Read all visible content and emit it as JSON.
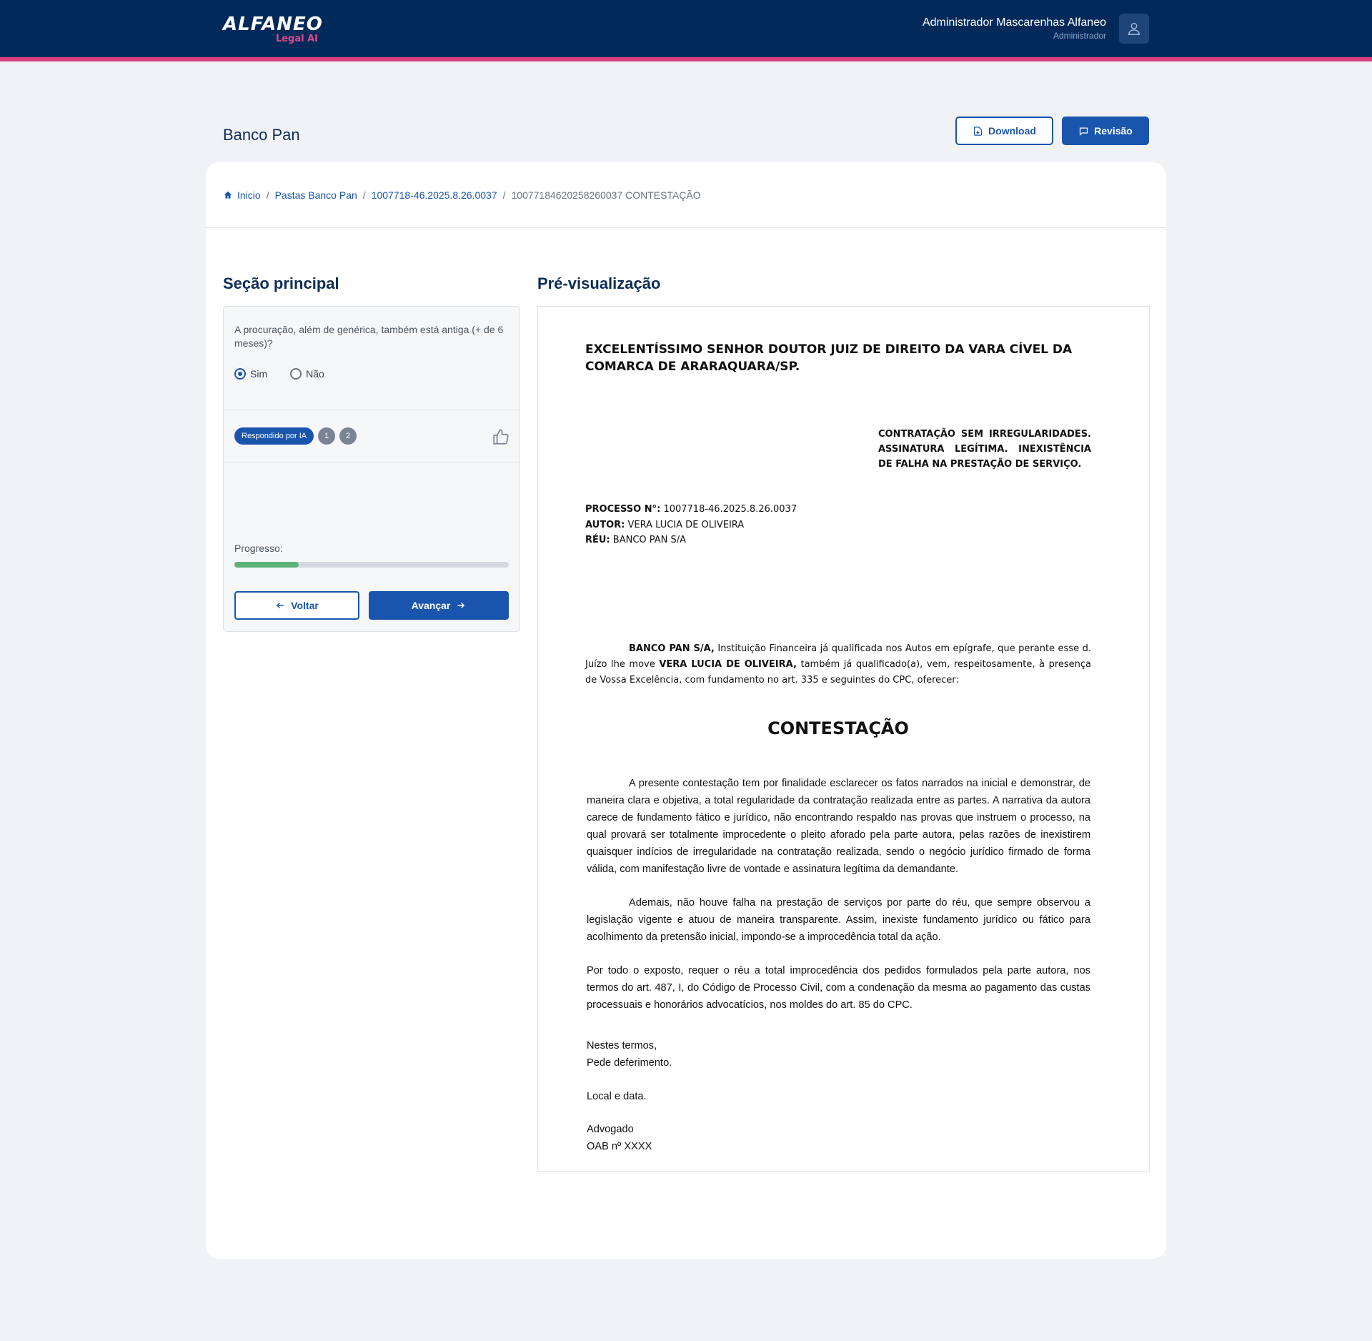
{
  "brand": {
    "name": "ALFANEO",
    "tagline": "Legal AI"
  },
  "user": {
    "name": "Administrador Mascarenhas Alfaneo",
    "role": "Administrador"
  },
  "header": {
    "title": "Banco Pan",
    "download_label": "Download",
    "revisao_label": "Revisão"
  },
  "breadcrumb": {
    "home": "Inicio",
    "folder": "Pastas Banco Pan",
    "process": "1007718-46.2025.8.26.0037",
    "current": "10077184620258260037 CONTESTAÇÃO",
    "separator": "/"
  },
  "main_section": {
    "title": "Seção principal",
    "question": "A procuração, além de genérica, também está antiga (+ de 6 meses)?",
    "options": [
      "Sim",
      "Não"
    ],
    "selected": "Sim",
    "ai_badge": "Respondido por IA",
    "refs": [
      "1",
      "2"
    ],
    "progress_label": "Progresso:",
    "progress": 0.235,
    "back_label": "Voltar",
    "next_label": "Avançar"
  },
  "preview": {
    "title": "Pré-visualização",
    "heading": "EXCELENTÍSSIMO SENHOR DOUTOR JUIZ DE DIREITO DA VARA CÍVEL DA COMARCA DE ARARAQUARA/SP.",
    "ementa": "CONTRATAÇÃO SEM IRREGULARIDADES. ASSINATURA LEGÍTIMA. INEXISTÊNCIA DE FALHA NA PRESTAÇÃO DE SERVIÇO.",
    "processo_label": "PROCESSO N°:",
    "processo_value": "1007718-46.2025.8.26.0037",
    "autor_label": "AUTOR:",
    "autor_value": "VERA LUCIA DE OLIVEIRA",
    "reu_label": "RÉU:",
    "reu_value": "BANCO PAN S/A",
    "intro_party": "BANCO PAN S/A,",
    "intro_text_1": "Instituição Financeira já qualificada nos Autos em epígrafe, que perante esse d. Juízo lhe move",
    "intro_party_2": "VERA LUCIA DE OLIVEIRA,",
    "intro_text_2": "também já qualificado(a), vem, respeitosamente, à presença de Vossa Excelência, com fundamento no art. 335 e seguintes do CPC, oferecer:",
    "doc_title": "CONTESTAÇÃO",
    "paragraph_1": "A presente contestação tem por finalidade esclarecer os fatos narrados na inicial e demonstrar, de maneira clara e objetiva, a total regularidade da contratação realizada entre as partes. A narrativa da autora carece de fundamento fático e jurídico, não encontrando respaldo nas provas que instruem o processo, na qual provará ser totalmente improcedente o pleito aforado pela parte autora, pelas razões de inexistirem quaisquer indícios de irregularidade na contratação realizada, sendo o negócio jurídico firmado de forma válida, com manifestação livre de vontade e assinatura legítima da demandante.",
    "paragraph_2": "Ademais, não houve falha na prestação de serviços por parte do réu, que sempre observou a legislação vigente e atuou de maneira transparente. Assim, inexiste fundamento jurídico ou fático para acolhimento da pretensão inicial, impondo-se a improcedência total da ação.",
    "paragraph_3": "Por todo o exposto, requer o réu a total improcedência dos pedidos formulados pela parte autora, nos termos do art. 487, I, do Código de Processo Civil, com a condenação da mesma ao pagamento das custas processuais e honorários advocatícios, nos moldes do art. 85 do CPC.",
    "closing_1": "Nestes termos,",
    "closing_2": "Pede deferimento.",
    "place_date": "Local e data.",
    "signer": "Advogado",
    "oab": "OAB nº XXXX"
  },
  "colors": {
    "navy": "#012a5b",
    "accent_pink": "#d8417e",
    "primary_blue": "#1a55ad",
    "progress_green": "#5db37a"
  },
  "icons": [
    "user-icon",
    "download-icon",
    "comment-icon",
    "home-icon",
    "thumbs-up-icon",
    "arrow-left-icon",
    "arrow-right-icon"
  ]
}
